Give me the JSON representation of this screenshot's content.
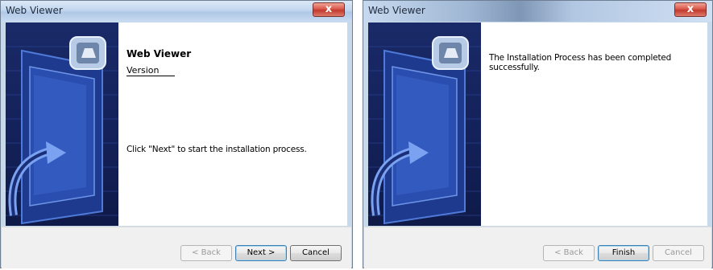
{
  "left_dialog": {
    "title": "Web Viewer",
    "close_glyph": "x",
    "heading": "Web Viewer",
    "version_label": "Version",
    "message": "Click \"Next\" to start the installation process.",
    "buttons": {
      "back_label": "< Back",
      "next_label": "Next >",
      "cancel_label": "Cancel"
    }
  },
  "right_dialog": {
    "title": "Web Viewer",
    "close_glyph": "x",
    "message": "The Installation Process has been completed successfully.",
    "buttons": {
      "back_label": "< Back",
      "finish_label": "Finish",
      "cancel_label": "Cancel"
    }
  },
  "icons": {
    "banner": "installer-banner-icon",
    "app": "web-viewer-app-icon",
    "close": "close-icon"
  },
  "colors": {
    "banner_dark": "#14215a",
    "banner_light": "#3a64c8",
    "close_red": "#c23a2e"
  }
}
